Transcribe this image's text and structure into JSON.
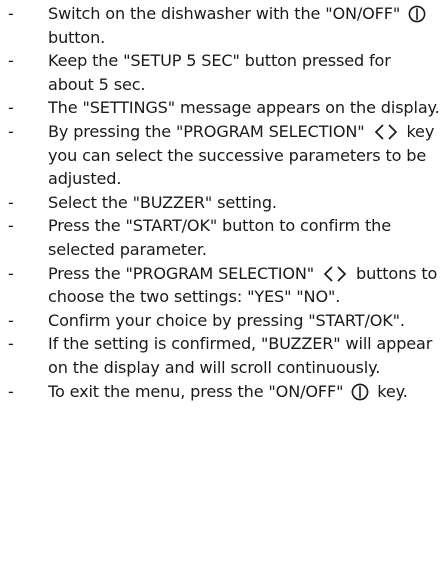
{
  "steps": [
    {
      "before": "Switch on the dishwasher with the \"ON/OFF\" ",
      "icon": "power-icon",
      "after": " button."
    },
    {
      "text": "Keep the \"SETUP 5 SEC\" button pressed for about 5 sec."
    },
    {
      "text": "The \"SETTINGS\" message appears on the display."
    },
    {
      "before": "By pressing the \"PROGRAM SELECTION\" ",
      "icon": "left-right-chevrons-icon",
      "after": " key you can select the successive parameters to be adjusted."
    },
    {
      "text": "Select the \"BUZZER\" setting."
    },
    {
      "text": "Press the \"START/OK\" button to confirm the selected parameter."
    },
    {
      "before": "Press the \"PROGRAM SELECTION\" ",
      "icon": "left-right-chevrons-icon",
      "after": " buttons to choose the two settings: \"YES\" \"NO\"."
    },
    {
      "text": "Confirm your choice by pressing \"START/OK\"."
    },
    {
      "text": "If the setting is confirmed, \"BUZZER\" will appear on the display and will scroll continuously."
    },
    {
      "before": "To exit the menu, press the \"ON/OFF\" ",
      "icon": "power-icon",
      "after": " key."
    }
  ],
  "dash_glyph": "-"
}
